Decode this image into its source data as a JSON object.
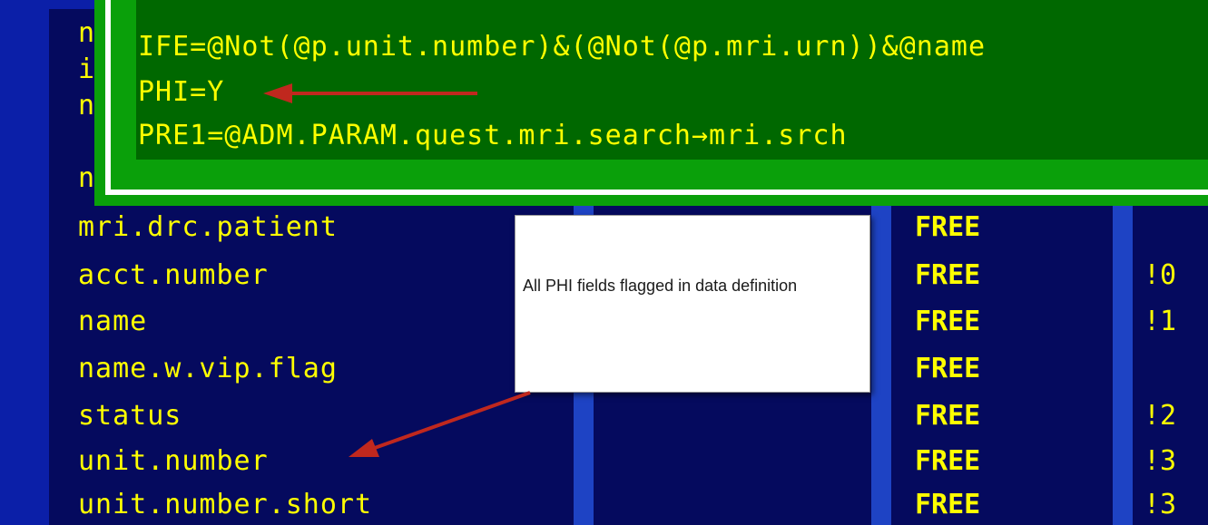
{
  "popup": {
    "lines": [
      "IFE=@Not(@p.unit.number)&(@Not(@p.mri.urn))&@name",
      "PHI=Y",
      "PRE1=@ADM.PARAM.quest.mri.search→mri.srch"
    ]
  },
  "obscured_rows": [
    "n",
    "i",
    "n",
    "n"
  ],
  "rows": [
    {
      "name": "mri.drc.patient",
      "type": "FREE",
      "num": ""
    },
    {
      "name": "acct.number",
      "type": "FREE",
      "num": "!0"
    },
    {
      "name": "name",
      "type": "FREE",
      "num": "!1"
    },
    {
      "name": "name.w.vip.flag",
      "type": "FREE",
      "num": ""
    },
    {
      "name": "status",
      "type": "FREE",
      "num": "!2"
    },
    {
      "name": "unit.number",
      "type": "FREE",
      "num": "!3"
    },
    {
      "name": "unit.number.short",
      "type": "FREE",
      "num": "!3"
    }
  ],
  "callout": {
    "text": "All PHI fields flagged in data definition"
  },
  "colors": {
    "terminal_bg": "#050a5e",
    "text": "#ffff00",
    "popup_green": "#0aa00a",
    "popup_field": "#006800",
    "arrow": "#c0281e"
  }
}
